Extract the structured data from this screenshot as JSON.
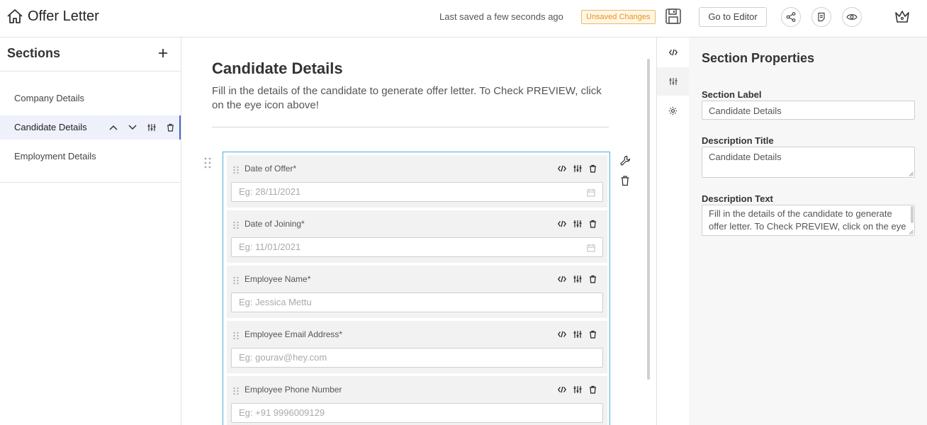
{
  "header": {
    "title": "Offer Letter",
    "last_saved": "Last saved a few seconds ago",
    "unsaved_badge": "Unsaved Changes",
    "go_to_editor": "Go to Editor",
    "icons": [
      "home-icon",
      "save-icon",
      "share-icon",
      "document-icon",
      "eye-icon",
      "crown-icon"
    ]
  },
  "sidebar": {
    "title": "Sections",
    "items": [
      {
        "label": "Company Details",
        "active": false
      },
      {
        "label": "Candidate Details",
        "active": true
      },
      {
        "label": "Employment Details",
        "active": false
      }
    ]
  },
  "main": {
    "title": "Candidate Details",
    "description": "Fill in the details of the candidate to generate offer letter. To Check PREVIEW, click on the eye icon above!",
    "fields": [
      {
        "label": "Date of Offer*",
        "placeholder": "Eg: 28/11/2021",
        "calendar": true
      },
      {
        "label": "Date of Joining*",
        "placeholder": "Eg: 11/01/2021",
        "calendar": true
      },
      {
        "label": "Employee Name*",
        "placeholder": "Eg: Jessica Mettu",
        "calendar": false
      },
      {
        "label": "Employee Email Address*",
        "placeholder": "Eg: gourav@hey.com",
        "calendar": false
      },
      {
        "label": "Employee Phone Number",
        "placeholder": "Eg: +91 9996009129",
        "calendar": false
      }
    ]
  },
  "panel": {
    "title": "Section Properties",
    "section_label_title": "Section Label",
    "section_label_value": "Candidate Details",
    "description_title_label": "Description Title",
    "description_title_value": "Candidate Details",
    "description_text_label": "Description Text",
    "description_text_value": "Fill in the details of the candidate to generate offer letter. To Check PREVIEW, click on the eye icon above!"
  },
  "colors": {
    "accent_border": "#4ab0d9",
    "active_item_bg": "#eef1fa",
    "active_item_bar": "#4a66c8",
    "badge_text": "#e8931e"
  }
}
